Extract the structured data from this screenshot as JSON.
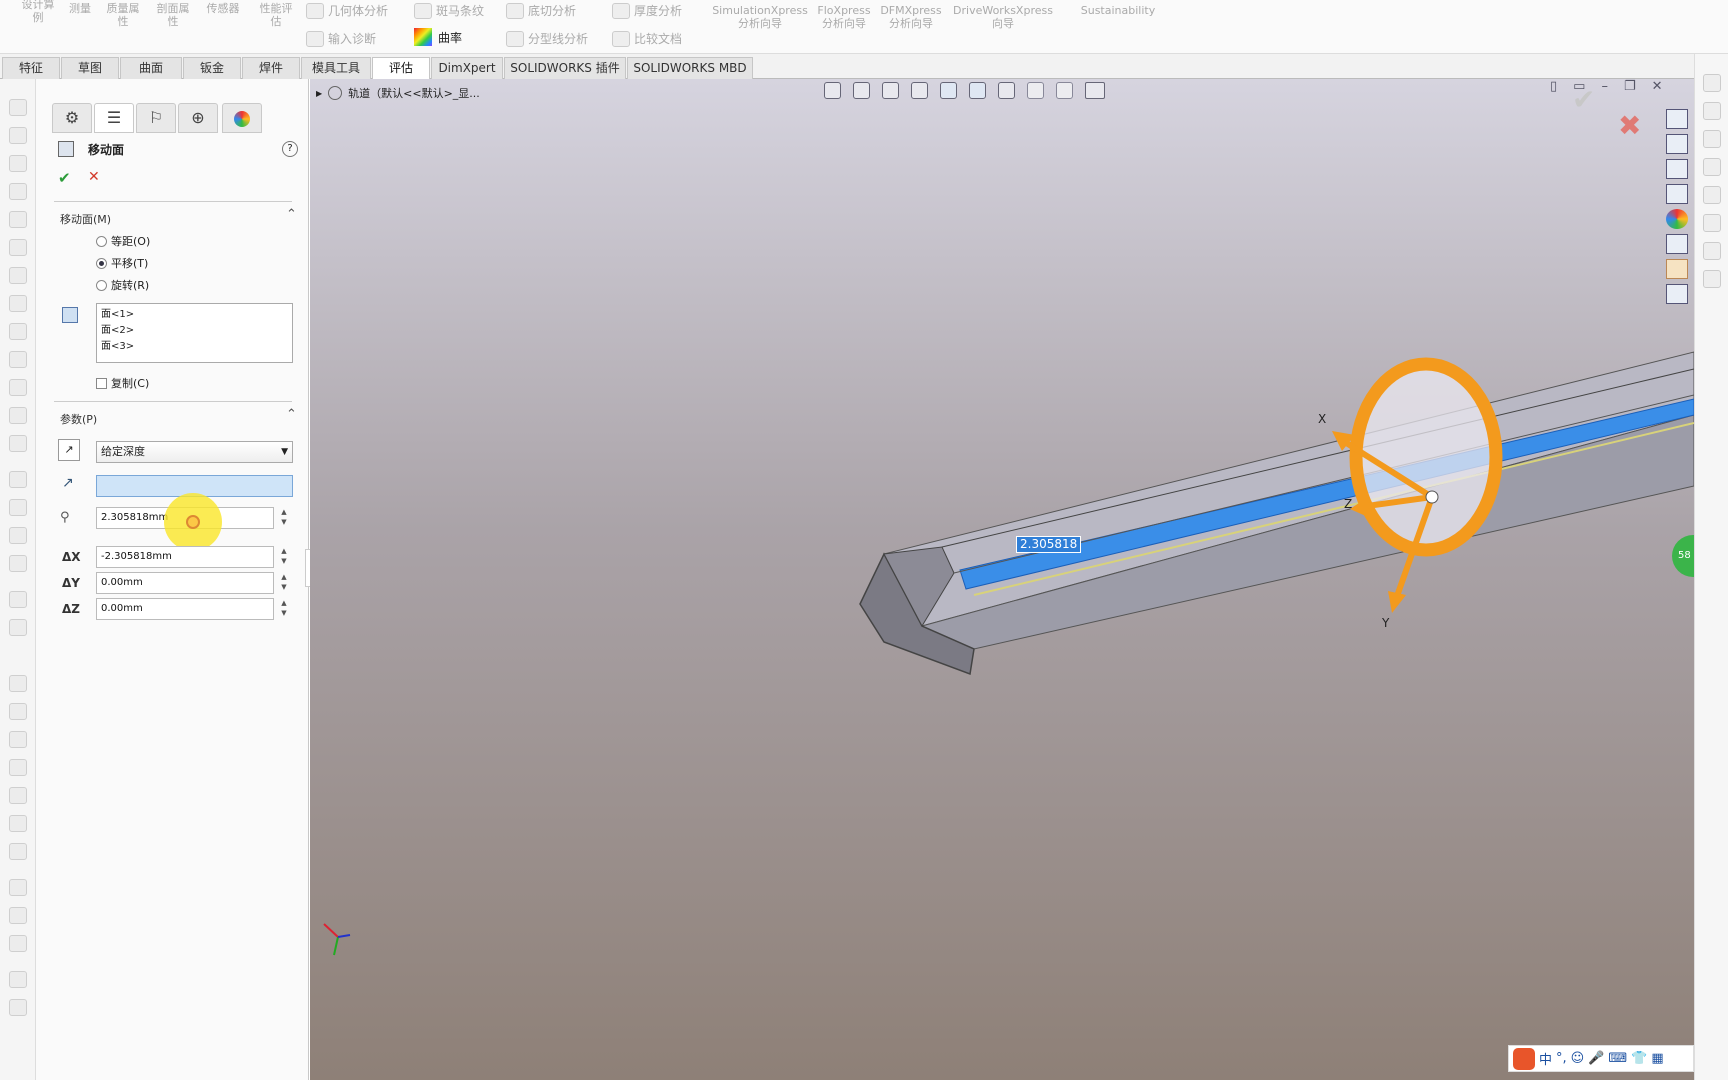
{
  "ribbon": {
    "big_buttons": [
      {
        "label": "设计算\n例"
      },
      {
        "label": "测量"
      },
      {
        "label": "质量属\n性"
      },
      {
        "label": "剖面属\n性"
      },
      {
        "label": "传感器"
      },
      {
        "label": "性能评\n估"
      }
    ],
    "small_buttons": [
      {
        "label": "几何体分析"
      },
      {
        "label": "输入诊断"
      },
      {
        "label": "斑马条纹"
      },
      {
        "label": "曲率"
      },
      {
        "label": "底切分析"
      },
      {
        "label": "分型线分析"
      },
      {
        "label": "厚度分析"
      },
      {
        "label": "比较文档"
      }
    ],
    "xpress": [
      {
        "label": "SimulationXpress\n分析向导"
      },
      {
        "label": "FloXpress\n分析向导"
      },
      {
        "label": "DFMXpress\n分析向导"
      },
      {
        "label": "DriveWorksXpress\n向导"
      },
      {
        "label": "Sustainability"
      }
    ]
  },
  "tabs": [
    "特征",
    "草图",
    "曲面",
    "钣金",
    "焊件",
    "模具工具",
    "评估",
    "DimXpert",
    "SOLIDWORKS 插件",
    "SOLIDWORKS MBD"
  ],
  "active_tab": "评估",
  "breadcrumb": "轨道（默认<<默认>_显...",
  "property_manager": {
    "title": "移动面",
    "help": "?",
    "ok": "✔",
    "cancel": "✕",
    "section_move": "移动面(M)",
    "options": [
      "等距(O)",
      "平移(T)",
      "旋转(R)"
    ],
    "selected_option": "平移(T)",
    "faces": [
      "面<1>",
      "面<2>",
      "面<3>"
    ],
    "copy_label": "复制(C)",
    "section_params": "参数(P)",
    "end_condition": "给定深度",
    "direction_value": "",
    "distance": "2.305818mm",
    "dx_label": "ΔX",
    "dy_label": "ΔY",
    "dz_label": "ΔZ",
    "dx": "-2.305818mm",
    "dy": "0.00mm",
    "dz": "0.00mm"
  },
  "viewport": {
    "dimension_callout": "2.305818",
    "axis_x": "X",
    "axis_y": "Y",
    "axis_z": "Z"
  },
  "taskbar": {
    "ime_lang": "中",
    "ime_punct": "°,",
    "green_badge": "58"
  },
  "colors": {
    "orange_handle": "#f39a1d",
    "selected_face_blue": "#3a8ee8",
    "body_gray": "#9c9ca8",
    "accept_green": "#2c9c3a",
    "cancel_red": "#d23a2a"
  }
}
